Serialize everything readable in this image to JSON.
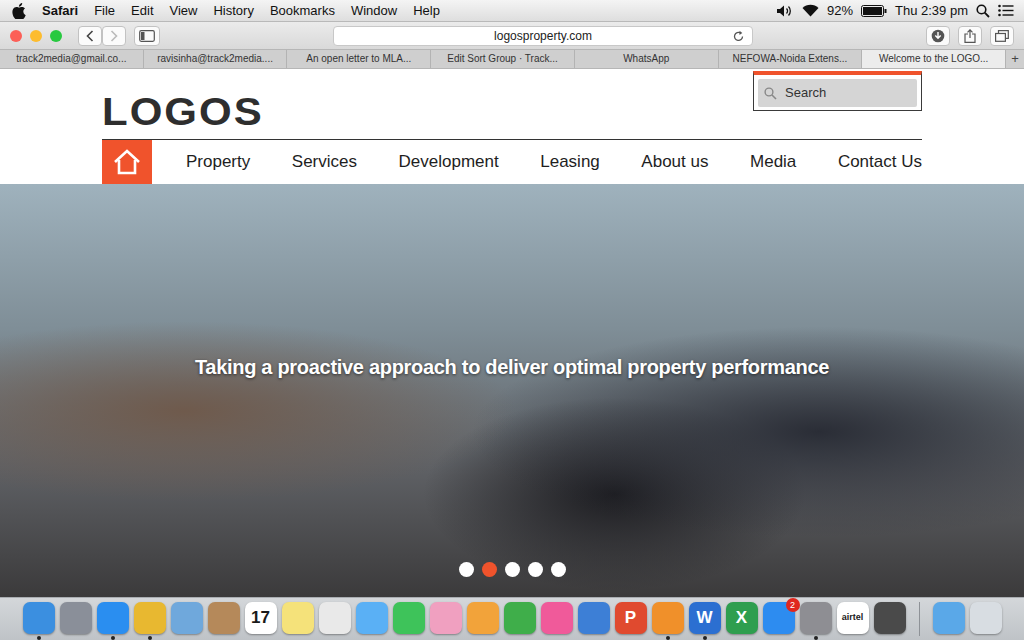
{
  "menubar": {
    "app": "Safari",
    "menus": [
      "File",
      "Edit",
      "View",
      "History",
      "Bookmarks",
      "Window",
      "Help"
    ],
    "battery": "92%",
    "clock": "Thu 2:39 pm"
  },
  "toolbar": {
    "address": "logosproperty.com"
  },
  "tabs": [
    {
      "label": "track2media@gmail.co...",
      "selected": false
    },
    {
      "label": "ravisinha@track2media....",
      "selected": false
    },
    {
      "label": "An open letter to MLA...",
      "selected": false
    },
    {
      "label": "Edit Sort Group · Track...",
      "selected": false
    },
    {
      "label": "WhatsApp",
      "selected": false
    },
    {
      "label": "NEFOWA-Noida Extens...",
      "selected": false
    },
    {
      "label": "Welcome to the LOGO...",
      "selected": true
    }
  ],
  "new_tab": "+",
  "site": {
    "logo": "LOGOS",
    "search": {
      "placeholder": "Search"
    },
    "nav": [
      "Property",
      "Services",
      "Development",
      "Leasing",
      "About us",
      "Media",
      "Contact Us"
    ],
    "hero": {
      "caption": "Taking a proactive approach to deliver optimal property performance",
      "slides": [
        {
          "selected": false
        },
        {
          "selected": true
        },
        {
          "selected": false
        },
        {
          "selected": false
        },
        {
          "selected": false
        }
      ]
    }
  },
  "dock": {
    "apps": [
      {
        "color": "#3b8fe0",
        "running": true
      },
      {
        "color": "#8a8f99",
        "running": false
      },
      {
        "color": "#2a8ef0",
        "running": true
      },
      {
        "color": "#e8b830",
        "running": true
      },
      {
        "color": "#6fa8dc",
        "running": false
      },
      {
        "color": "#b5895a",
        "running": false
      },
      {
        "color": "#ffffff",
        "running": false,
        "text": "17"
      },
      {
        "color": "#f5e27a",
        "running": false
      },
      {
        "color": "#e9e9e9",
        "running": false
      },
      {
        "color": "#5ab0f5",
        "running": false
      },
      {
        "color": "#3ec35a",
        "running": false
      },
      {
        "color": "#f0a0c0",
        "running": false
      },
      {
        "color": "#f2a33a",
        "running": false
      },
      {
        "color": "#3fae4a",
        "running": false
      },
      {
        "color": "#f05a9a",
        "running": false
      },
      {
        "color": "#3d7fd6",
        "running": false
      },
      {
        "color": "#e04a2f",
        "running": false,
        "text": "P"
      },
      {
        "color": "#f0902a",
        "running": true
      },
      {
        "color": "#2b6fd1",
        "running": true,
        "text": "W"
      },
      {
        "color": "#2e9e4f",
        "running": false,
        "text": "X"
      },
      {
        "color": "#2d8cf0",
        "running": false,
        "badge": "2"
      },
      {
        "color": "#8e8e93",
        "running": true
      },
      {
        "color": "#ffffff",
        "running": false,
        "text": "airtel"
      },
      {
        "color": "#4a4a4a",
        "running": false
      }
    ],
    "stacks": [
      {
        "color": "#5aa8e8",
        "running": false
      },
      {
        "color": "#d8dde2",
        "running": false
      }
    ]
  }
}
